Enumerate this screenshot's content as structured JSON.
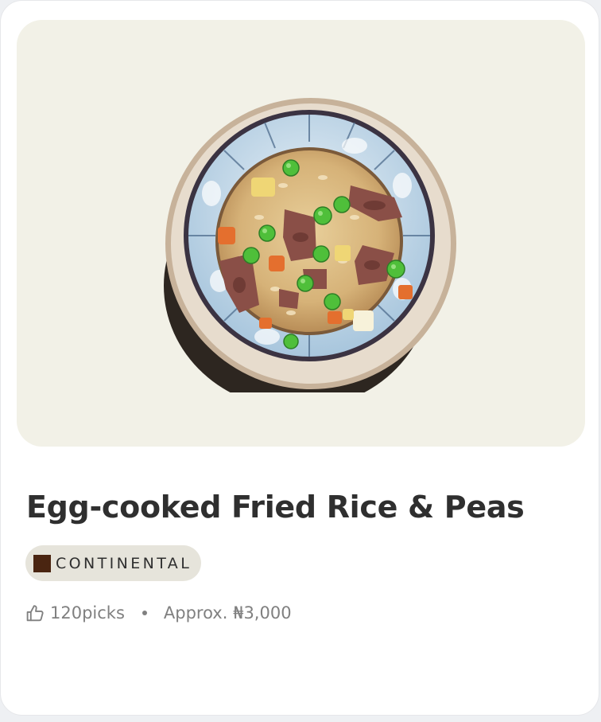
{
  "card": {
    "title": "Egg-cooked Fried Rice & Peas",
    "cuisine_tag": {
      "label": "CONTINENTAL",
      "swatch_color": "#4a2511"
    },
    "picks": "120picks",
    "price": "Approx. ₦3,000",
    "image_icon": "fried-rice-bowl",
    "like_icon": "thumbs-up-icon"
  },
  "colors": {
    "card_background": "#ffffff",
    "hero_background": "#f2f1e7",
    "tag_background": "#e6e4db",
    "title_text": "#2f2f2f",
    "meta_text": "#808080"
  }
}
